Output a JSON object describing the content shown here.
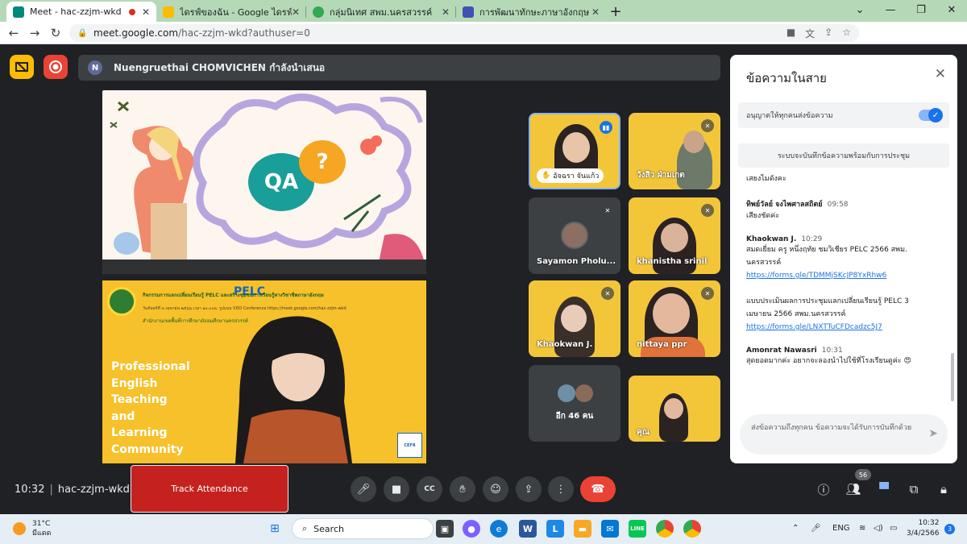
{
  "browser": {
    "tabs": [
      {
        "title": "Meet - hac-zzjm-wkd",
        "color": "#00897b",
        "recording": true
      },
      {
        "title": "ไดรฟ์ของฉัน - Google ไดรฟ์",
        "color": "#fbbc04",
        "recording": false
      },
      {
        "title": "กลุ่มนิเทศ สพม.นครสวรรค์",
        "color": "#34a853",
        "recording": false
      },
      {
        "title": "การพัฒนาทักษะภาษาอังกฤษ English",
        "color": "#3f51b5",
        "recording": false
      }
    ],
    "url_host": "meet.google.com",
    "url_path": "/hac-zzjm-wkd?authuser=0"
  },
  "meet": {
    "presenter_initial": "N",
    "presenter_text": "Nuengruethai CHOMVICHEN กำลังนำเสนอ",
    "slide1": {
      "qa": "QA",
      "question": "?"
    },
    "slide2": {
      "pelc": "PELC",
      "header": "กิจกรรมการแลกเปลี่ยนเรียนรู้ PELC และสร้างชุมชนการเรียนรู้ทางวิชาชีพภาษาอังกฤษ",
      "subheader": "วันจันทร์ที่ ๓ เมษายน ๒๕๖๖ เวลา ๑๐.๐๐น. รูปแบบ VDO Conference https://meet.google.com/hac-zzjm-wkd",
      "org": "สำนักงานเขตพื้นที่การศึกษามัธยมศึกษานครสวรรค์",
      "title_lines": [
        "Professional",
        "English",
        "Teaching",
        "and",
        "Learning",
        "Community"
      ],
      "badge": "CEFR"
    },
    "tiles": [
      {
        "name": "อัจฉรา จันแก้ว",
        "speaking": true
      },
      {
        "name": "วังสิว ฝ่ามเกต"
      },
      {
        "name": "Sayamon Pholu..."
      },
      {
        "name": "khanistha srinil"
      },
      {
        "name": "Khaokwan J."
      },
      {
        "name": "nittaya ppr"
      },
      {
        "name": "อีก 46 คน"
      },
      {
        "name": "คุณ"
      }
    ],
    "clock": "10:32",
    "meeting_code": "hac-zzjm-wkd",
    "track_attendance": "Track Attendance",
    "participants_count": "56"
  },
  "chat": {
    "title": "ข้อความในสาย",
    "allow_label": "อนุญาตให้ทุกคนส่งข้อความ",
    "record_note": "ระบบจะบันทึกข้อความพร้อมกับการประชุม",
    "messages": [
      {
        "who": "",
        "time": "",
        "lines": [
          "เสยงไมดังคะ"
        ],
        "links": []
      },
      {
        "who": "ทิพย์วัลย์ จงไพศาลสถิตย์",
        "time": "09:58",
        "lines": [
          "เสียงชัดค่ะ"
        ],
        "links": []
      },
      {
        "who": "Khaokwan J.",
        "time": "10:29",
        "lines": [
          "สมดเยี่ยม ครู หนึ่งฤทัย ชมวิเชียร PELC 2566 สพม.",
          "นครสวรรค์"
        ],
        "links": [
          "https://forms.gle/TDMMjSKcJP8YxRhw6"
        ]
      },
      {
        "who": "",
        "time": "",
        "lines": [
          "แบบประเมินผลการประชุมแลกเปลี่ยนเรียนรู้ PELC 3",
          "เมษายน 2566 สพม.นครสวรรค์"
        ],
        "links": [
          "https://forms.gle/LNXTTuCFDcadzc5J7"
        ]
      },
      {
        "who": "Amonrat Nawasri",
        "time": "10:31",
        "lines": [
          "สุดยอดมากค่ะ อยากจะลองนำไปใช้ที่โรงเรียนดูค่ะ 😍"
        ],
        "links": []
      }
    ],
    "input_placeholder": "ส่งข้อความถึงทุกคน ข้อความจะได้รับการบันทึกด้วย"
  },
  "taskbar": {
    "temp": "31°C",
    "weather": "มีแดด",
    "search": "Search",
    "lang": "ENG",
    "time": "10:32",
    "date": "3/4/2566",
    "notifications": "3"
  }
}
